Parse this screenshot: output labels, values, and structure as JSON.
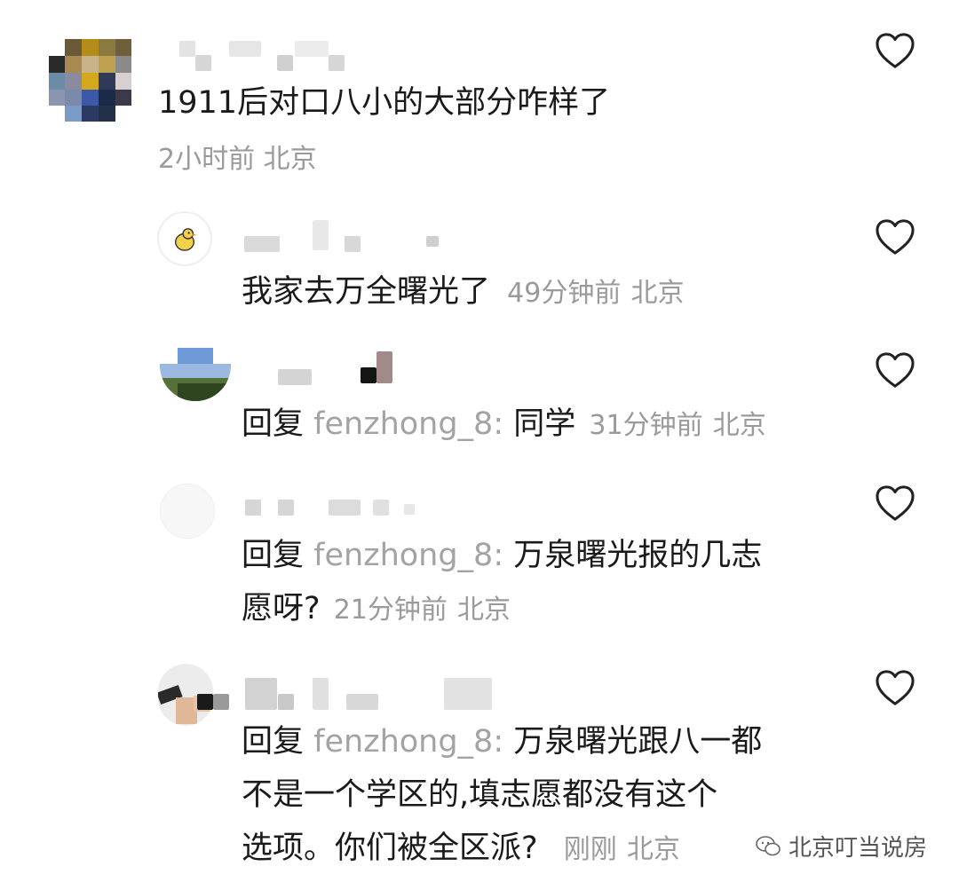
{
  "comments": [
    {
      "text": "1911后对口八小的大部分咋样了",
      "time": "2小时前",
      "location": "北京"
    },
    {
      "text": "我家去万全曙光了",
      "time": "49分钟前",
      "location": "北京"
    },
    {
      "reply_label": "回复",
      "reply_to": "fenzhong_8:",
      "text": "同学",
      "time": "31分钟前",
      "location": "北京"
    },
    {
      "reply_label": "回复",
      "reply_to": "fenzhong_8:",
      "text_line1": "万泉曙光报的几志",
      "text_line2": "愿呀?",
      "time": "21分钟前",
      "location": "北京"
    },
    {
      "reply_label": "回复",
      "reply_to": "fenzhong_8:",
      "text_line1": "万泉曙光跟八一都",
      "text_line2": "不是一个学区的,填志愿都没有这个",
      "text_line3": "选项。你们被全区派?",
      "time": "刚刚",
      "location": "北京"
    }
  ],
  "watermark": {
    "text": "北京叮当说房"
  },
  "icons": {
    "like": "heart-outline-icon",
    "watermark": "wechat-icon"
  },
  "colors": {
    "text": "#1a1a1a",
    "meta": "#9a9a9a",
    "username": "#a3a3a3"
  }
}
